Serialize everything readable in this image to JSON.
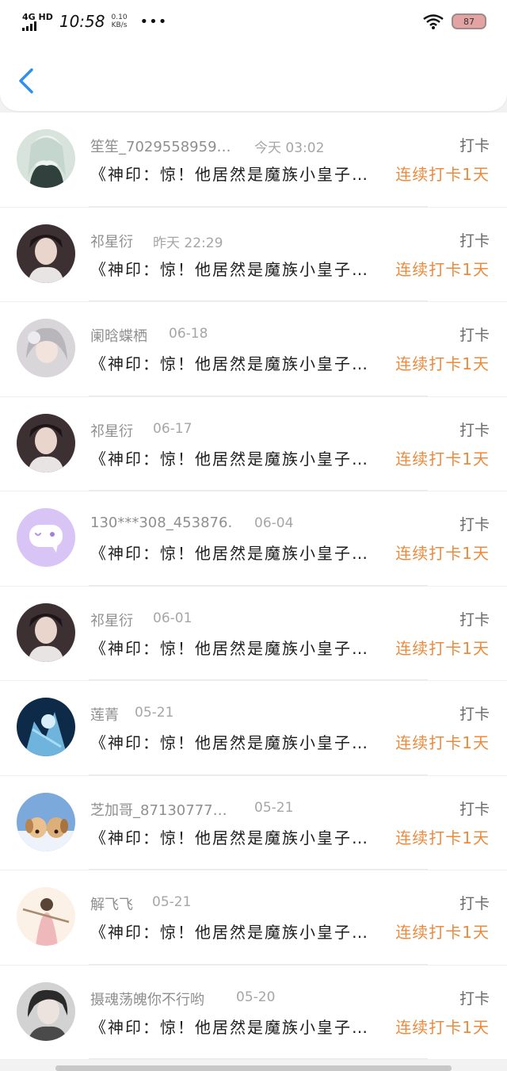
{
  "status_bar": {
    "network": "4G HD",
    "time": "10:58",
    "speed_value": "0.10",
    "speed_unit": "KB/s",
    "more": "•••",
    "battery": "87"
  },
  "rows": [
    {
      "user": "笙笙_7029558959…",
      "time": "今天 03:02",
      "tag": "打卡",
      "book": "《神印：惊！他居然是魔族小皇子…",
      "streak": "连续打卡1天",
      "avatar": "avatar-silver-hair"
    },
    {
      "user": "祁星衍",
      "time": "昨天 22:29",
      "tag": "打卡",
      "book": "《神印：惊！他居然是魔族小皇子…",
      "streak": "连续打卡1天",
      "avatar": "avatar-dark-hair"
    },
    {
      "user": "阑晗蝶栖",
      "time": "06-18",
      "tag": "打卡",
      "book": "《神印：惊！他居然是魔族小皇子…",
      "streak": "连续打卡1天",
      "avatar": "avatar-white-hair"
    },
    {
      "user": "祁星衍",
      "time": "06-17",
      "tag": "打卡",
      "book": "《神印：惊！他居然是魔族小皇子…",
      "streak": "连续打卡1天",
      "avatar": "avatar-dark-hair"
    },
    {
      "user": "130***308_453876…",
      "time": "06-04",
      "tag": "打卡",
      "book": "《神印：惊！他居然是魔族小皇子…",
      "streak": "连续打卡1天",
      "avatar": "avatar-default-chat"
    },
    {
      "user": "祁星衍",
      "time": "06-01",
      "tag": "打卡",
      "book": "《神印：惊！他居然是魔族小皇子…",
      "streak": "连续打卡1天",
      "avatar": "avatar-dark-hair"
    },
    {
      "user": "莲菁",
      "time": "05-21",
      "tag": "打卡",
      "book": "《神印：惊！他居然是魔族小皇子…",
      "streak": "连续打卡1天",
      "avatar": "avatar-ice-blue"
    },
    {
      "user": "芝加哥_87130777…",
      "time": "05-21",
      "tag": "打卡",
      "book": "《神印：惊！他居然是魔族小皇子…",
      "streak": "连续打卡1天",
      "avatar": "avatar-puppies"
    },
    {
      "user": "解飞飞",
      "time": "05-21",
      "tag": "打卡",
      "book": "《神印：惊！他居然是魔族小皇子…",
      "streak": "连续打卡1天",
      "avatar": "avatar-pink-figure"
    },
    {
      "user": "摄魂荡魄你不行哟",
      "time": "05-20",
      "tag": "打卡",
      "book": "《神印：惊！他居然是魔族小皇子…",
      "streak": "连续打卡1天",
      "avatar": "avatar-grey-portrait"
    }
  ],
  "colors": {
    "accent_blue": "#2f8ff0",
    "streak_orange": "#ec8a3c",
    "default_avatar_purple": "#d9c4f6"
  }
}
